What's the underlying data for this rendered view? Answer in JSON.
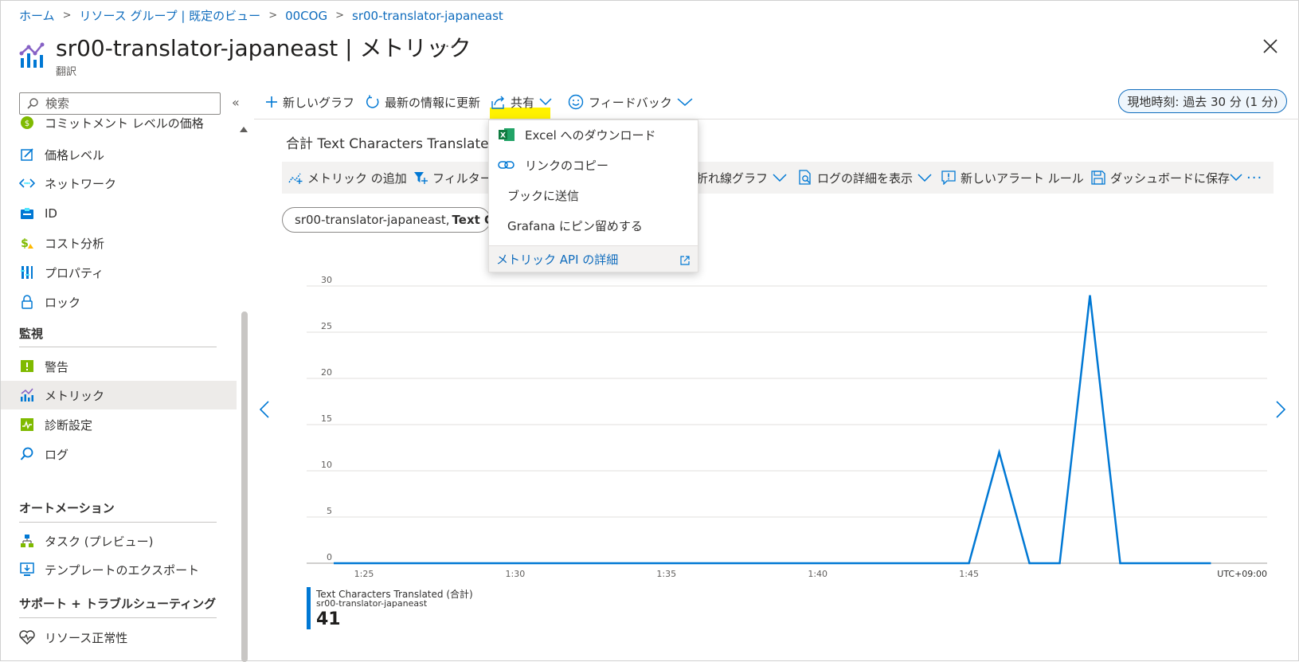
{
  "breadcrumb": [
    {
      "label": "ホーム"
    },
    {
      "label": "リソース グループ | 既定のビュー"
    },
    {
      "label": "00COG"
    },
    {
      "label": "sr00-translator-japaneast"
    }
  ],
  "header": {
    "title": "sr00-translator-japaneast | メトリック",
    "subtitle": "翻訳",
    "more": "···"
  },
  "sidebar": {
    "search_placeholder": "検索",
    "collapse": "«",
    "items_top": [
      {
        "label": "コミットメント レベルの価格",
        "icon": "commitment-icon"
      },
      {
        "label": "価格レベル",
        "icon": "pricing-icon"
      },
      {
        "label": "ネットワーク",
        "icon": "network-icon"
      },
      {
        "label": "ID",
        "icon": "identity-icon"
      },
      {
        "label": "コスト分析",
        "icon": "cost-icon"
      },
      {
        "label": "プロパティ",
        "icon": "properties-icon"
      },
      {
        "label": "ロック",
        "icon": "lock-icon"
      }
    ],
    "monitoring": {
      "heading": "監視",
      "items": [
        {
          "label": "警告",
          "icon": "alert-icon"
        },
        {
          "label": "メトリック",
          "icon": "metrics-icon"
        },
        {
          "label": "診断設定",
          "icon": "diagnostic-icon"
        },
        {
          "label": "ログ",
          "icon": "logs-icon"
        }
      ]
    },
    "automation": {
      "heading": "オートメーション",
      "items": [
        {
          "label": "タスク (プレビュー)",
          "icon": "tasks-icon"
        },
        {
          "label": "テンプレートのエクスポート",
          "icon": "export-icon"
        }
      ]
    },
    "support": {
      "heading": "サポート + トラブルシューティング",
      "items": [
        {
          "label": "リソース正常性",
          "icon": "health-icon"
        }
      ]
    }
  },
  "toolbar": {
    "new_chart": "新しいグラフ",
    "refresh": "最新の情報に更新",
    "share": "共有",
    "feedback": "フィードバック",
    "time_range": "現地時刻: 過去 30 分 (1 分)"
  },
  "share_menu": {
    "excel": "Excel へのダウンロード",
    "copy_link": "リンクのコピー",
    "send_workbook": "ブックに送信",
    "grafana": "Grafana にピン留めする",
    "api_details": "メトリック API の詳細"
  },
  "chart_panel": {
    "title": "合計 Text Characters Translated 対",
    "add_metric": "メトリック の追加",
    "filter": "フィルター",
    "line_chart": "折れ線グラフ",
    "view_logs": "ログの詳細を表示",
    "new_alert": "新しいアラート ルール",
    "save_dashboard": "ダッシュボードに保存",
    "more": "···",
    "chip_resource": "sr00-translator-japaneast,",
    "chip_metric": "Text C",
    "legend_name": "Text Characters Translated (合計)",
    "legend_resource": "sr00-translator-japaneast",
    "legend_value": "41"
  },
  "chart_data": {
    "type": "line",
    "timezone": "UTC+09:00",
    "ylim": [
      0,
      30
    ],
    "yticks": [
      0,
      5,
      10,
      15,
      20,
      25,
      30
    ],
    "xticks": [
      "1:25",
      "1:30",
      "1:35",
      "1:40",
      "1:45"
    ],
    "xtick_minutes": [
      85,
      90,
      95,
      100,
      105
    ],
    "xlim_minutes": [
      84,
      114
    ],
    "series": [
      {
        "name": "Text Characters Translated (合計)",
        "color": "#0078d4",
        "x_minutes": [
          84.0,
          85,
          86,
          87,
          88,
          89,
          90,
          91,
          92,
          93,
          94,
          95,
          96,
          97,
          98,
          99,
          100,
          101,
          102,
          103,
          104,
          105,
          106,
          107,
          108,
          109,
          110,
          111,
          112,
          113
        ],
        "values": [
          0,
          0,
          0,
          0,
          0,
          0,
          0,
          0,
          0,
          0,
          0,
          0,
          0,
          0,
          0,
          0,
          0,
          0,
          0,
          0,
          0,
          0,
          12,
          0,
          0,
          29,
          0,
          0,
          0,
          0
        ]
      }
    ]
  }
}
